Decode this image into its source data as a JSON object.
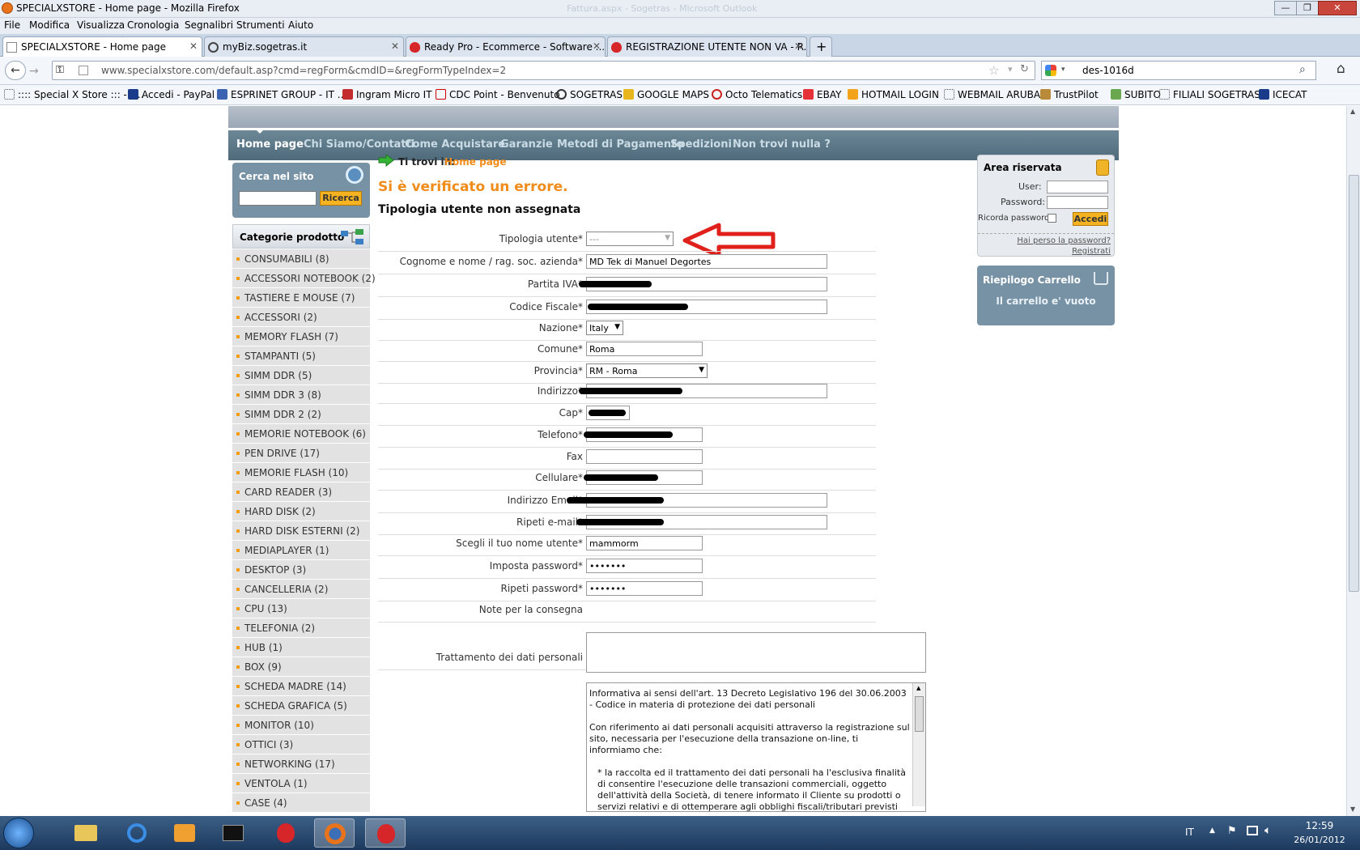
{
  "window": {
    "title": "SPECIALXSTORE - Home page - Mozilla Firefox",
    "blurred_title": "Fattura.aspx - Sogetras - Microsoft Outlook"
  },
  "menu": [
    "File",
    "Modifica",
    "Visualizza",
    "Cronologia",
    "Segnalibri",
    "Strumenti",
    "Aiuto"
  ],
  "tabs": [
    {
      "label": "SPECIALXSTORE - Home page",
      "active": true
    },
    {
      "label": "myBiz.sogetras.it",
      "active": false
    },
    {
      "label": "Ready Pro - Ecommerce - Software ...",
      "active": false
    },
    {
      "label": "REGISTRAZIONE UTENTE NON VA - R...",
      "active": false
    }
  ],
  "url": "www.specialxstore.com/default.asp?cmd=regForm&cmdID=&regFormTypeIndex=2",
  "search_value": "des-1016d",
  "bookmarks": [
    ":::: Special X Store ::: - P...",
    "Accedi - PayPal",
    "ESPRINET GROUP - IT ...",
    "Ingram Micro IT",
    "CDC Point - Benvenuto",
    "SOGETRAS",
    "GOOGLE MAPS",
    "Octo Telematics",
    "EBAY",
    "HOTMAIL LOGIN",
    "WEBMAIL ARUBA",
    "TrustPilot",
    "SUBITO",
    "FILIALI SOGETRAS",
    "ICECAT"
  ],
  "site_nav": [
    "Home page",
    "Chi Siamo/Contatti",
    "Come Acquistare",
    "Garanzie",
    "Metodi di Pagamento",
    "Spedizioni",
    "Non trovi nulla ?"
  ],
  "search_panel": {
    "title": "Cerca nel sito",
    "button": "Ricerca"
  },
  "categories_title": "Categorie prodotto",
  "categories": [
    "CONSUMABILI (8)",
    "ACCESSORI NOTEBOOK (2)",
    "TASTIERE E MOUSE (7)",
    "ACCESSORI (2)",
    "MEMORY FLASH (7)",
    "STAMPANTI (5)",
    "SIMM DDR (5)",
    "SIMM DDR 3 (8)",
    "SIMM DDR 2 (2)",
    "MEMORIE NOTEBOOK (6)",
    "PEN DRIVE (17)",
    "MEMORIE FLASH (10)",
    "CARD READER (3)",
    "HARD DISK (2)",
    "HARD DISK ESTERNI (2)",
    "MEDIAPLAYER (1)",
    "DESKTOP (3)",
    "CANCELLERIA (2)",
    "CPU (13)",
    "TELEFONIA (2)",
    "HUB (1)",
    "BOX (9)",
    "SCHEDA MADRE (14)",
    "SCHEDA GRAFICA (5)",
    "MONITOR (10)",
    "OTTICI (3)",
    "NETWORKING (17)",
    "VENTOLA (1)",
    "CASE (4)"
  ],
  "breadcrumb": {
    "prefix": "Ti trovi in:",
    "link": "Home page"
  },
  "error_title": "Si è verificato un errore.",
  "error_msg": "Tipologia utente non assegnata",
  "form": {
    "tipologia": {
      "label": "Tipologia utente*",
      "value": "---"
    },
    "cognome": {
      "label": "Cognome e nome / rag. soc. azienda*",
      "value": "MD Tek di Manuel Degortes"
    },
    "piva": {
      "label": "Partita IVA*"
    },
    "cf": {
      "label": "Codice Fiscale*"
    },
    "nazione": {
      "label": "Nazione*",
      "value": "Italy"
    },
    "comune": {
      "label": "Comune*",
      "value": "Roma"
    },
    "provincia": {
      "label": "Provincia*",
      "value": "RM - Roma"
    },
    "indirizzo": {
      "label": "Indirizzo*"
    },
    "cap": {
      "label": "Cap*"
    },
    "telefono": {
      "label": "Telefono*"
    },
    "fax": {
      "label": "Fax"
    },
    "cellulare": {
      "label": "Cellulare*"
    },
    "email": {
      "label": "Indirizzo Email*"
    },
    "email2": {
      "label": "Ripeti e-mail*"
    },
    "username": {
      "label": "Scegli il tuo nome utente*",
      "value": "mammorm"
    },
    "password": {
      "label": "Imposta password*",
      "value": "•••••••"
    },
    "password2": {
      "label": "Ripeti password*",
      "value": "•••••••"
    },
    "note": {
      "label": "Note per la consegna"
    },
    "privacy": {
      "label": "Trattamento dei dati personali",
      "p1": "Informativa ai sensi dell'art. 13 Decreto Legislativo 196 del 30.06.2003 - Codice in materia di protezione dei dati personali",
      "p2": "Con riferimento ai dati personali acquisiti attraverso la registrazione sul sito, necessaria per l'esecuzione della transazione on-line, ti informiamo che:",
      "p3": "* la raccolta ed il trattamento dei dati personali ha l'esclusiva finalità di consentire l'esecuzione delle transazioni commerciali, oggetto dell'attività della Società, di tenere informato il Cliente su prodotti o servizi relativi e di ottemperare agli obblighi fiscali/tributari previsti dalla legge, dai regolamenti e dalla normativa"
    }
  },
  "area": {
    "title": "Area riservata",
    "user": "User:",
    "password": "Password:",
    "remember": "Ricorda password",
    "button": "Accedi",
    "lost": "Hai perso la password?",
    "register": "Registrati"
  },
  "cart": {
    "title": "Riepilogo Carrello",
    "empty": "Il carrello e' vuoto"
  },
  "taskbar": {
    "lang": "IT",
    "time": "12:59",
    "date": "26/01/2012"
  },
  "colors": {
    "accent_orange": "#f08c1a",
    "nav_bg": "#5b7787",
    "panel": "#7792a5",
    "arrow_red": "#e0201a"
  }
}
